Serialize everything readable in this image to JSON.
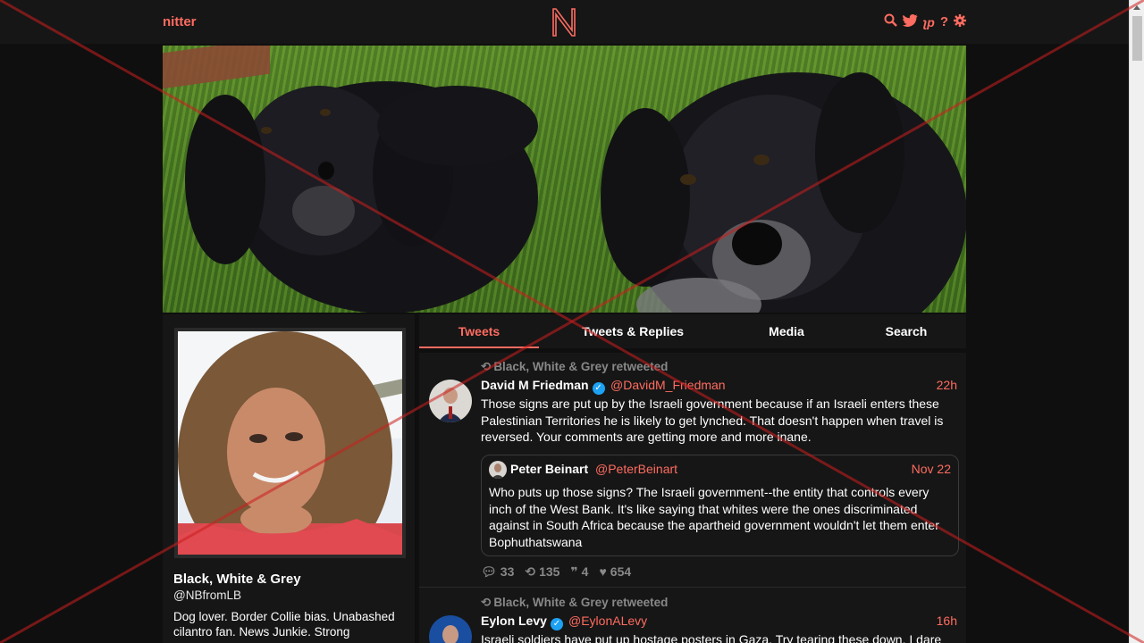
{
  "nav": {
    "brand": "nitter",
    "logo_letter": "N",
    "icons": [
      "search-icon",
      "twitter-icon",
      "rss-icon",
      "help-icon",
      "settings-icon"
    ],
    "accent": "#ff6c60"
  },
  "profile": {
    "name": "Black, White & Grey",
    "handle": "@NBfromLB",
    "bio": "Dog lover. Border Collie bias. Unabashed cilantro fan. News Junkie. Strong"
  },
  "tabs": [
    {
      "label": "Tweets",
      "active": true
    },
    {
      "label": "Tweets & Replies",
      "active": false
    },
    {
      "label": "Media",
      "active": false
    },
    {
      "label": "Search",
      "active": false
    }
  ],
  "tweets": [
    {
      "retweet_by": "Black, White & Grey retweeted",
      "name": "David M Friedman",
      "verified": true,
      "handle": "@DavidM_Friedman",
      "date": "22h",
      "text": "Those signs are put up by the Israeli government because if an Israeli enters these Palestinian Territories he is likely to get lynched. That doesn't happen when travel is reversed. Your comments are getting more and more inane.",
      "quote": {
        "name": "Peter Beinart",
        "handle": "@PeterBeinart",
        "date": "Nov 22",
        "text": "Who puts up those signs? The Israeli government--the entity that controls every inch of the West Bank. It's like saying that whites were the ones discriminated against in South Africa because the apartheid government wouldn't let them enter Bophuthatswana"
      },
      "stats": {
        "replies": "33",
        "retweets": "135",
        "quotes": "4",
        "likes": "654"
      }
    },
    {
      "retweet_by": "Black, White & Grey retweeted",
      "name": "Eylon Levy",
      "verified": true,
      "handle": "@EylonALevy",
      "date": "16h",
      "text": "Israeli soldiers have put up hostage posters in Gaza. Try tearing these down, I dare"
    }
  ]
}
